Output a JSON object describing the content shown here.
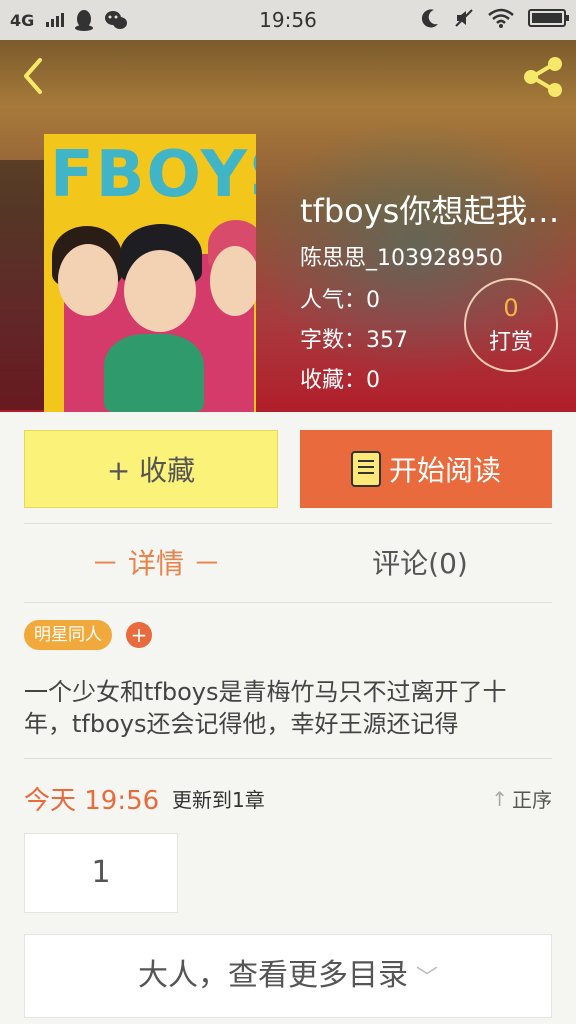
{
  "status_bar": {
    "network": "4G",
    "time": "19:56"
  },
  "book": {
    "title": "tfboys你想起我…",
    "author": "陈思思_103928950",
    "popularity": "人气：0",
    "word_count": "字数：357",
    "favorites": "收藏：0",
    "reward_count": "0",
    "reward_label": "打赏",
    "cover_text": "FBOYS"
  },
  "actions": {
    "favorite_label": "+ 收藏",
    "read_label": "开始阅读"
  },
  "tabs": {
    "detail": "－ 详情 －",
    "comments": "评论(0)"
  },
  "tag": {
    "label": "明星同人",
    "add": "+"
  },
  "description": "一个少女和tfboys是青梅竹马只不过离开了十年，tfboys还会记得他，幸好王源还记得",
  "updates": {
    "time": "今天 19:56",
    "text": "更新到1章",
    "order_label": "正序",
    "order_icon": "↑"
  },
  "chapters": [
    "1"
  ],
  "more_label": "大人，查看更多目录",
  "more_icon": "﹀"
}
